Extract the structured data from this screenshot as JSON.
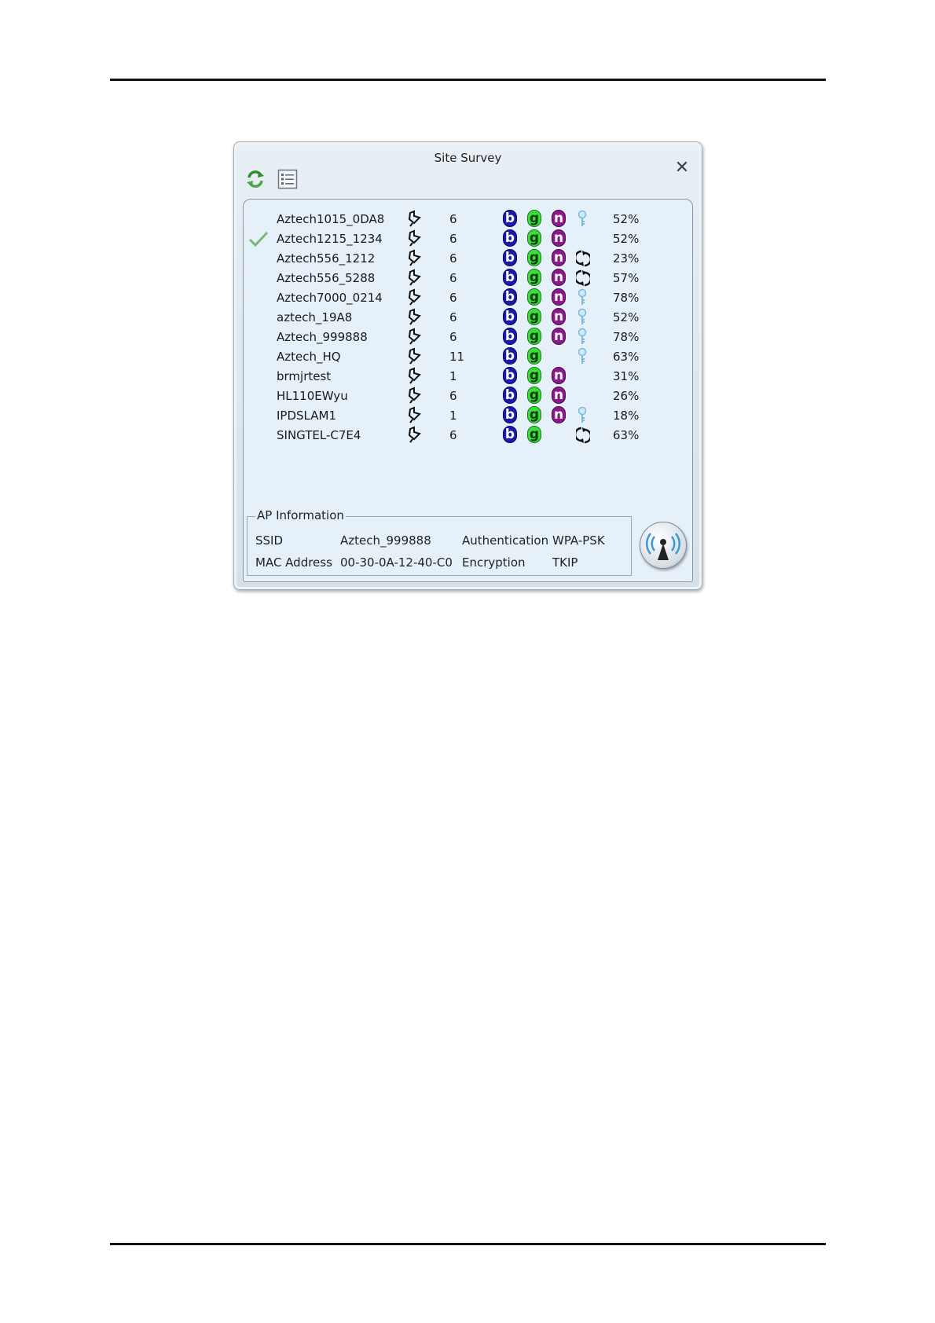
{
  "window": {
    "title": "Site Survey"
  },
  "networks": [
    {
      "ssid": "Aztech1015_0DA8",
      "channel": "6",
      "b": "b",
      "g": "g",
      "n": "n",
      "security": "wep",
      "signal": "52%",
      "connected": false
    },
    {
      "ssid": "Aztech1215_1234",
      "channel": "6",
      "b": "b",
      "g": "g",
      "n": "n",
      "security": "none",
      "signal": "52%",
      "connected": true
    },
    {
      "ssid": "Aztech556_1212",
      "channel": "6",
      "b": "b",
      "g": "g",
      "n": "n",
      "security": "wpa",
      "signal": "23%",
      "connected": false
    },
    {
      "ssid": "Aztech556_5288",
      "channel": "6",
      "b": "b",
      "g": "g",
      "n": "n",
      "security": "wpa",
      "signal": "57%",
      "connected": false
    },
    {
      "ssid": "Aztech7000_0214",
      "channel": "6",
      "b": "b",
      "g": "g",
      "n": "n",
      "security": "wep",
      "signal": "78%",
      "connected": false
    },
    {
      "ssid": "aztech_19A8",
      "channel": "6",
      "b": "b",
      "g": "g",
      "n": "n",
      "security": "wep",
      "signal": "52%",
      "connected": false
    },
    {
      "ssid": "Aztech_999888",
      "channel": "6",
      "b": "b",
      "g": "g",
      "n": "n",
      "security": "wep",
      "signal": "78%",
      "connected": false
    },
    {
      "ssid": "Aztech_HQ",
      "channel": "11",
      "b": "b",
      "g": "g",
      "n": "",
      "security": "wep",
      "signal": "63%",
      "connected": false
    },
    {
      "ssid": "brmjrtest",
      "channel": "1",
      "b": "b",
      "g": "g",
      "n": "n",
      "security": "none",
      "signal": "31%",
      "connected": false
    },
    {
      "ssid": "HL110EWyu",
      "channel": "6",
      "b": "b",
      "g": "g",
      "n": "n",
      "security": "none",
      "signal": "26%",
      "connected": false
    },
    {
      "ssid": "IPDSLAM1",
      "channel": "1",
      "b": "b",
      "g": "g",
      "n": "n",
      "security": "wep",
      "signal": "18%",
      "connected": false
    },
    {
      "ssid": "SINGTEL-C7E4",
      "channel": "6",
      "b": "b",
      "g": "g",
      "n": "",
      "security": "wpa",
      "signal": "63%",
      "connected": false
    }
  ],
  "ap_info": {
    "group_label": "AP Information",
    "ssid_label": "SSID",
    "ssid_value": "Aztech_999888",
    "mac_label": "MAC Address",
    "mac_value": "00-30-0A-12-40-C0",
    "auth_label": "Authentication",
    "auth_value": "WPA-PSK",
    "enc_label": "Encryption",
    "enc_value": "TKIP"
  },
  "icons": {
    "refresh": "refresh-icon",
    "list_view": "list-view-icon",
    "close": "close-icon",
    "connected": "checkmark-icon",
    "network_type": "infrastructure-icon",
    "wep": "key-icon",
    "wpa": "wpa-arrows-icon",
    "wifi": "wireless-antenna-icon"
  },
  "colors": {
    "b_badge": "#1a1aa8",
    "g_badge": "#3bdc3b",
    "n_badge": "#8a1a8a",
    "key_icon": "#8fc8e8"
  }
}
